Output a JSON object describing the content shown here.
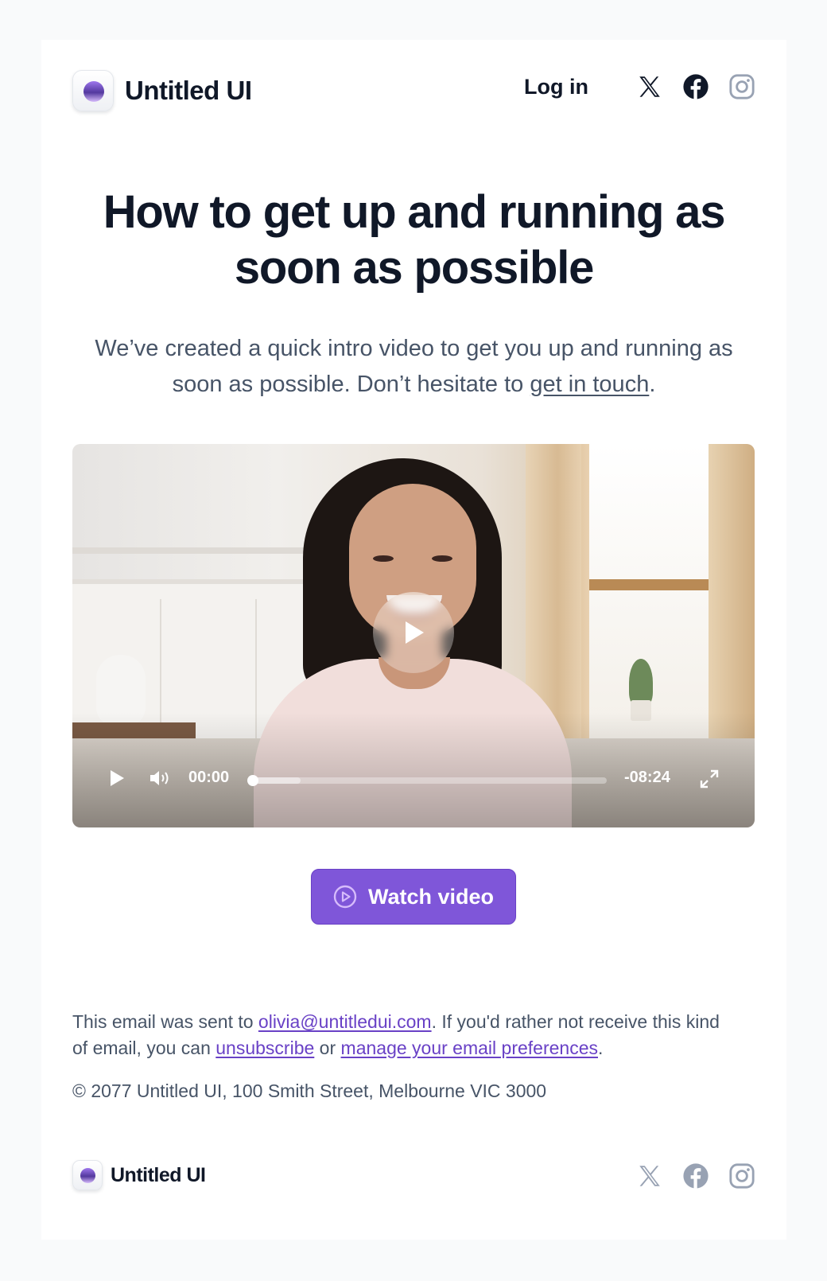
{
  "brand": {
    "name": "Untitled UI"
  },
  "header": {
    "login_label": "Log in",
    "social_icons": [
      "x-icon",
      "facebook-icon",
      "instagram-icon"
    ]
  },
  "hero": {
    "title": "How to get up and running as soon as possible",
    "intro_text": "We’ve created a quick intro video to get you up and running as soon as possible. Don’t hesitate to ",
    "intro_link": "get in touch",
    "intro_end": "."
  },
  "video": {
    "current_time": "00:00",
    "remaining_time": "-08:24",
    "progress": 0.0,
    "buffered": 0.14
  },
  "cta": {
    "label": "Watch video"
  },
  "legal": {
    "p1": "This email was sent to ",
    "email": "olivia@untitledui.com",
    "p2": ". If you'd rather not receive this kind of email, you can ",
    "unsubscribe": "unsubscribe",
    "p3": " or ",
    "manage": "manage your email preferences",
    "p4": "."
  },
  "copyright": "© 2077 Untitled UI, 100 Smith Street, Melbourne VIC 3000",
  "footer": {
    "brand": "Untitled UI"
  },
  "colors": {
    "accent": "#7f56d9",
    "link": "#6941c6",
    "text_primary": "#101828",
    "text_secondary": "#475467",
    "footer_icon": "#98a2b3"
  }
}
